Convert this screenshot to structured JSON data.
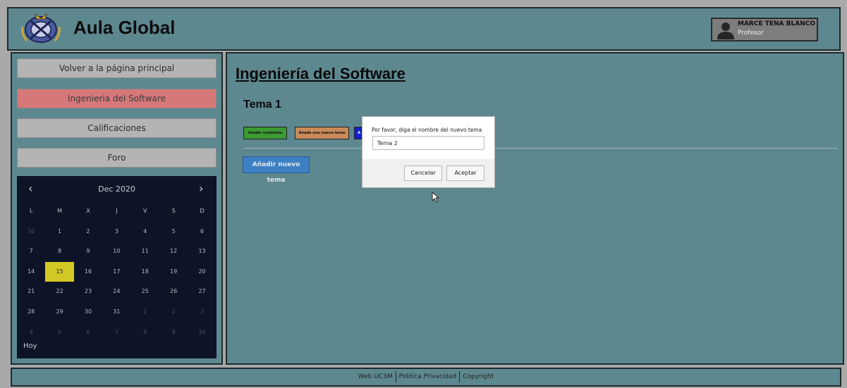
{
  "header": {
    "title": "Aula Global"
  },
  "user": {
    "name": "MARCE TENA BLANCO",
    "role": "Profesor"
  },
  "sidebar": {
    "items": [
      {
        "label": "Volver a la página principal",
        "active": false
      },
      {
        "label": "Ingenieria del Software",
        "active": true
      },
      {
        "label": "Calificaciones",
        "active": false
      },
      {
        "label": "Foro",
        "active": false
      }
    ]
  },
  "calendar": {
    "month_label": "Dec 2020",
    "weekdays": [
      "L",
      "M",
      "X",
      "J",
      "V",
      "S",
      "D"
    ],
    "weeks": [
      [
        "30",
        "1",
        "2",
        "3",
        "4",
        "5",
        "6"
      ],
      [
        "7",
        "8",
        "9",
        "10",
        "11",
        "12",
        "13"
      ],
      [
        "14",
        "15",
        "16",
        "17",
        "18",
        "19",
        "20"
      ],
      [
        "21",
        "22",
        "23",
        "24",
        "25",
        "26",
        "27"
      ],
      [
        "28",
        "29",
        "30",
        "31",
        "1",
        "2",
        "3"
      ],
      [
        "4",
        "5",
        "6",
        "7",
        "8",
        "9",
        "10"
      ]
    ],
    "today_label": "Hoy",
    "highlighted_day": "15"
  },
  "main": {
    "course_title": "Ingeniería del Software",
    "topic_title": "Tema 1",
    "btn_add_content": "Añadir contenido",
    "btn_add_task": "Añade una nueva tarea",
    "btn_third": "A",
    "btn_new_topic": "Añadir nuevo tema"
  },
  "dialog": {
    "message": "Por favor, diga el nombre del nuevo tema",
    "input_value": "Tema 2",
    "cancel_label": "Cancelar",
    "accept_label": "Aceptar"
  },
  "footer": {
    "links": [
      "Web UC3M",
      "Politica Privacidad",
      "Copyright"
    ]
  },
  "colors": {
    "panel_bg": "#5e8890",
    "active_nav": "#d67878",
    "calendar_bg": "#0e1428",
    "today_highlight": "#d2c924",
    "add_content": "#3c9a33",
    "add_task": "#c98a59",
    "new_topic": "#3e80c4"
  }
}
